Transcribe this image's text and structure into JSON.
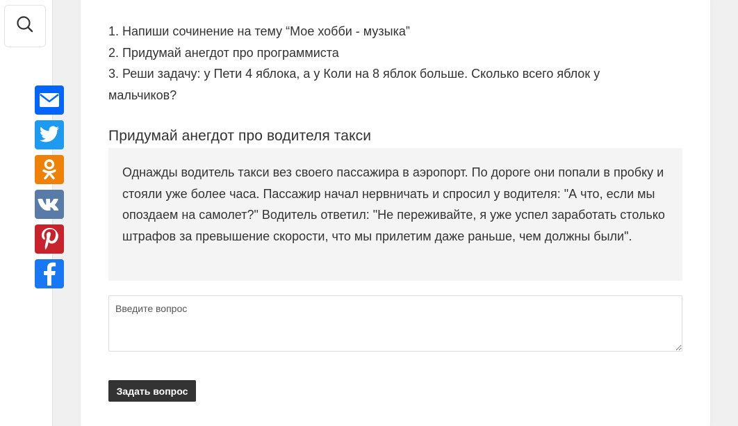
{
  "sidebar": {
    "search_icon": "search-icon",
    "share_buttons": [
      {
        "name": "email",
        "icon": "envelope-icon",
        "color": "#0166ff"
      },
      {
        "name": "twitter",
        "icon": "twitter-bird-icon",
        "color": "#1d9bf0"
      },
      {
        "name": "odnoklassniki",
        "icon": "odnoklassniki-icon",
        "color": "#ee8208"
      },
      {
        "name": "vkontakte",
        "icon": "vk-icon",
        "color": "#587ba8"
      },
      {
        "name": "pinterest",
        "icon": "pinterest-icon",
        "color": "#c8232c"
      },
      {
        "name": "facebook",
        "icon": "facebook-icon",
        "color": "#1877f2"
      }
    ]
  },
  "content": {
    "list_items": [
      "1. Напиши сочинение на тему “Мое хобби - музыка”",
      "2. Придумай анегдот про программиста",
      "3. Реши задачу: у Пети 4 яблока, а у Коли на 8 яблок больше. Сколько всего яблок у мальчиков?"
    ],
    "heading": "Придумай анегдот про водителя такси",
    "answer": "Однажды водитель такси вез своего пассажира в аэропорт. По дороге они попали в пробку и стояли уже более часа. Пассажир начал нервничать и спросил у водителя: \"А что, если мы опоздаем на самолет?\" Водитель ответил: \"Не переживайте, я уже успел заработать столько штрафов за превышение скорости, что мы прилетим даже раньше, чем должны были\"."
  },
  "form": {
    "question_placeholder": "Введите вопрос",
    "question_value": "",
    "submit_label": "Задать вопрос"
  },
  "colors": {
    "background": "#f0f0f0",
    "card": "#ffffff",
    "answer_bg": "#f4f4f4",
    "button": "#333333"
  }
}
